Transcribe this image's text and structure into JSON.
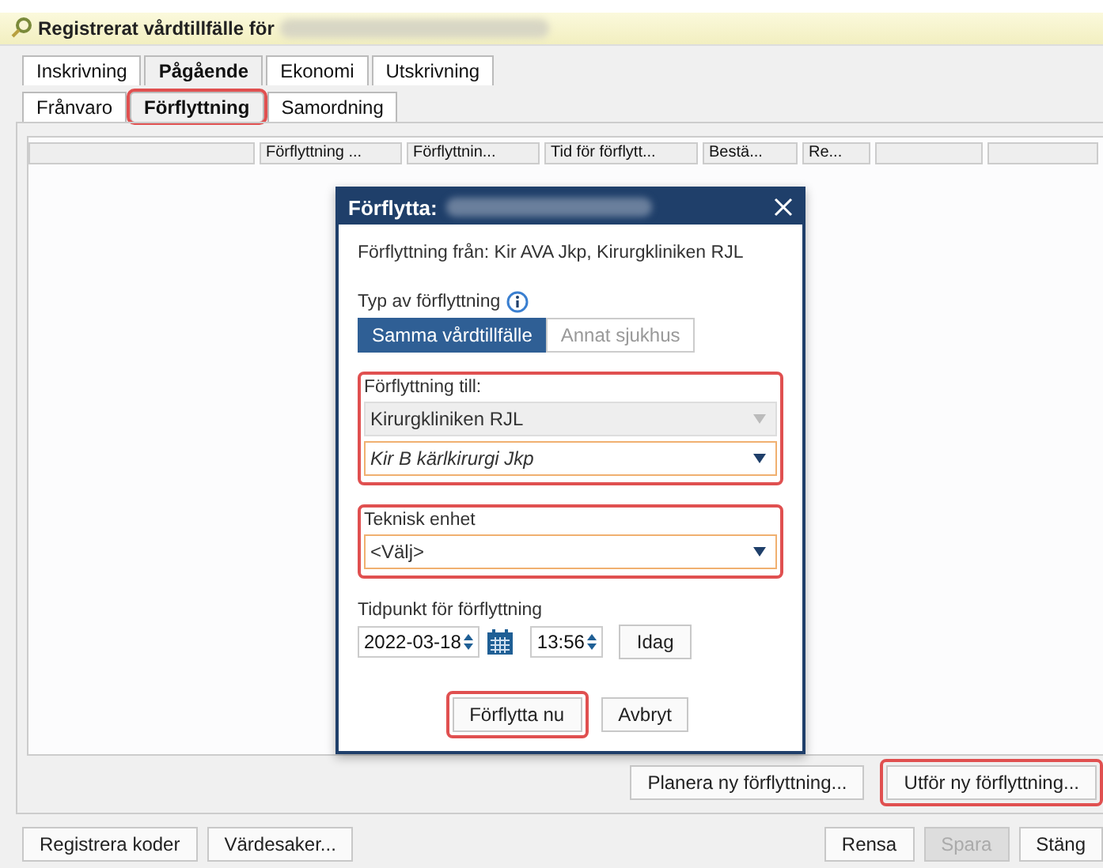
{
  "window": {
    "title": "Registrerat vårdtillfälle för"
  },
  "tabs": [
    {
      "label": "Inskrivning",
      "selected": false
    },
    {
      "label": "Pågående",
      "selected": true
    },
    {
      "label": "Ekonomi",
      "selected": false
    },
    {
      "label": "Utskrivning",
      "selected": false
    }
  ],
  "subtabs": [
    {
      "label": "Frånvaro",
      "selected": false,
      "highlighted": false
    },
    {
      "label": "Förflyttning",
      "selected": true,
      "highlighted": true
    },
    {
      "label": "Samordning",
      "selected": false,
      "highlighted": false
    }
  ],
  "table": {
    "columns": [
      "",
      "Förflyttning ...",
      "Förflyttnin...",
      "Tid för förflytt...",
      "Bestä...",
      "Re...",
      "",
      ""
    ]
  },
  "panel_buttons": [
    {
      "label": "Planera ny förflyttning...",
      "highlighted": false
    },
    {
      "label": "Utför ny förflyttning...",
      "highlighted": true
    }
  ],
  "footer_left": [
    {
      "label": "Registrera koder",
      "disabled": false
    },
    {
      "label": "Värdesaker...",
      "disabled": false
    }
  ],
  "footer_right": [
    {
      "label": "Rensa",
      "disabled": false
    },
    {
      "label": "Spara",
      "disabled": true
    },
    {
      "label": "Stäng",
      "disabled": false
    }
  ],
  "dialog": {
    "title": "Förflytta:",
    "from": "Förflyttning från: Kir AVA Jkp, Kirurgkliniken RJL",
    "type_label": "Typ av förflyttning",
    "type_options": [
      {
        "label": "Samma vårdtillfälle",
        "selected": true
      },
      {
        "label": "Annat sjukhus",
        "selected": false
      }
    ],
    "groups": [
      {
        "label": "Förflyttning till:",
        "highlighted": true,
        "fields": [
          {
            "value": "Kirurgkliniken RJL",
            "disabled": true,
            "italic": false
          },
          {
            "value": "Kir B kärlkirurgi Jkp",
            "disabled": false,
            "italic": true
          }
        ]
      },
      {
        "label": "Teknisk enhet",
        "highlighted": true,
        "fields": [
          {
            "value": "<Välj>",
            "disabled": false,
            "italic": false
          }
        ]
      }
    ],
    "time_label": "Tidpunkt för förflyttning",
    "date": "2022-03-18",
    "time": "13:56",
    "today": "Idag",
    "buttons": [
      {
        "label": "Förflytta nu",
        "highlighted": true
      },
      {
        "label": "Avbryt",
        "highlighted": false
      }
    ]
  }
}
